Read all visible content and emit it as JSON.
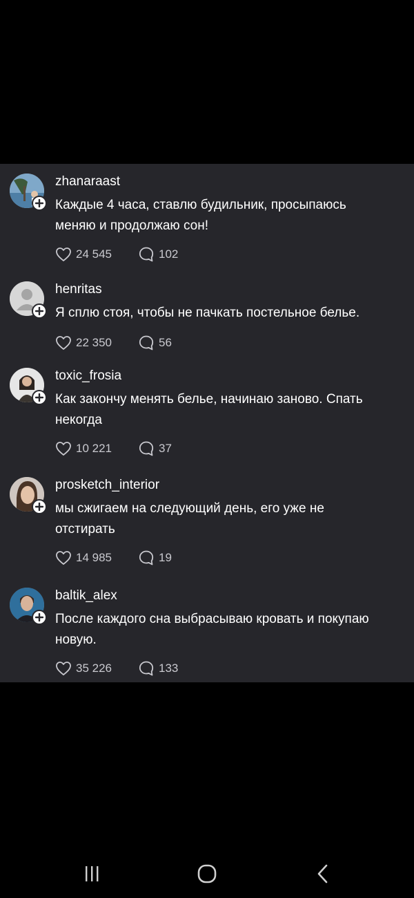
{
  "comments": [
    {
      "username": "zhanaraast",
      "text": "Каждые 4 часа, ставлю будильник, просыпаюсь меняю и продолжаю сон!",
      "likes": "24 545",
      "replies": "102",
      "avatar": "beach-photo-avatar"
    },
    {
      "username": "henritas",
      "text": "Я сплю стоя, чтобы не пачкать постельное белье.",
      "likes": "22 350",
      "replies": "56",
      "avatar": "default-person-avatar"
    },
    {
      "username": "toxic_frosia",
      "text": "Как закончу менять белье, начинаю заново. Спать некогда",
      "likes": "10 221",
      "replies": "37",
      "avatar": "woman-photo-avatar"
    },
    {
      "username": "prosketch_interior",
      "text": "мы сжигаем на следующий день, его уже не отстирать",
      "likes": "14 985",
      "replies": "19",
      "avatar": "woman-face-avatar"
    },
    {
      "username": "baltik_alex",
      "text": "После каждого сна выбрасываю кровать и покупаю новую.",
      "likes": "35 226",
      "replies": "133",
      "avatar": "man-photo-avatar"
    }
  ],
  "icons": {
    "like": "heart-outline-icon",
    "reply": "speech-bubble-icon",
    "follow": "plus-circle-icon"
  },
  "navigation": {
    "recent": "recent-apps-icon",
    "home": "home-icon",
    "back": "back-icon"
  },
  "colors": {
    "panel_background": "#26262b",
    "screen_background": "#000000",
    "text": "#ffffff",
    "secondary_text": "#c9c9cf"
  }
}
